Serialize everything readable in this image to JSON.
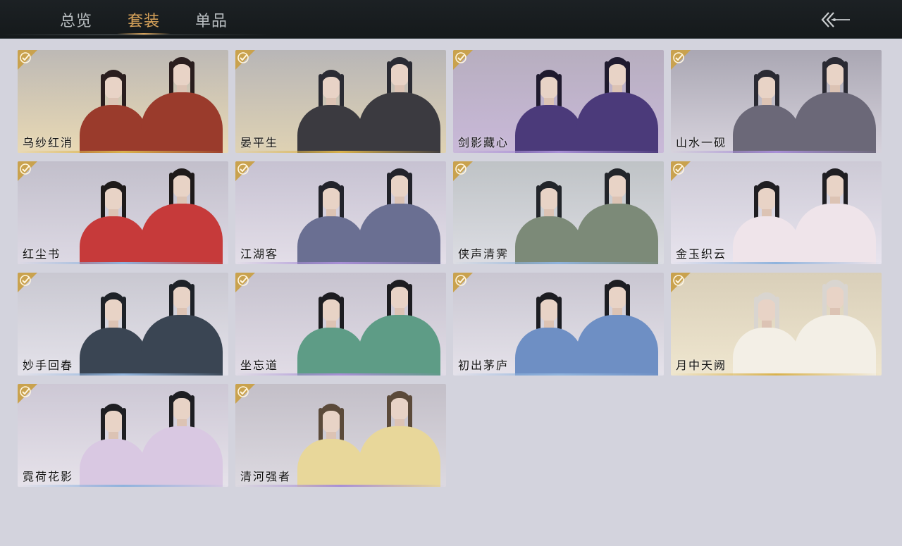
{
  "nav": {
    "tabs": [
      {
        "label": "总览"
      },
      {
        "label": "套装"
      },
      {
        "label": "单品"
      }
    ],
    "active_tab": "套装",
    "back_icon": "double-chevron-left-arrow-icon"
  },
  "colors": {
    "accent_gold": "#d8a35a",
    "check_badge": "#c9a24e",
    "background": "#d3d3dd",
    "topbar": "#1a1e21"
  },
  "outfits": [
    {
      "name": "乌纱红消",
      "owned": true,
      "rarity_color": "#d9b24c"
    },
    {
      "name": "晏平生",
      "owned": true,
      "rarity_color": "#d9b24c"
    },
    {
      "name": "剑影藏心",
      "owned": true,
      "rarity_color": "#a88fd6"
    },
    {
      "name": "山水一砚",
      "owned": true,
      "rarity_color": "#a88fd6"
    },
    {
      "name": "红尘书",
      "owned": true,
      "rarity_color": "#8fb3dd"
    },
    {
      "name": "江湖客",
      "owned": true,
      "rarity_color": "#a88fd6"
    },
    {
      "name": "侠声清霁",
      "owned": true,
      "rarity_color": "#8fb3dd"
    },
    {
      "name": "金玉织云",
      "owned": true,
      "rarity_color": "#8fb3dd"
    },
    {
      "name": "妙手回春",
      "owned": true,
      "rarity_color": "#8fb3dd"
    },
    {
      "name": "坐忘道",
      "owned": true,
      "rarity_color": "#a88fd6"
    },
    {
      "name": "初出茅庐",
      "owned": true,
      "rarity_color": "#8fb3dd"
    },
    {
      "name": "月中天阙",
      "owned": true,
      "rarity_color": "#d9b24c"
    },
    {
      "name": "霓荷花影",
      "owned": true,
      "rarity_color": "#8fb3dd"
    },
    {
      "name": "清河强者",
      "owned": true,
      "rarity_color": "#a88fd6"
    }
  ]
}
